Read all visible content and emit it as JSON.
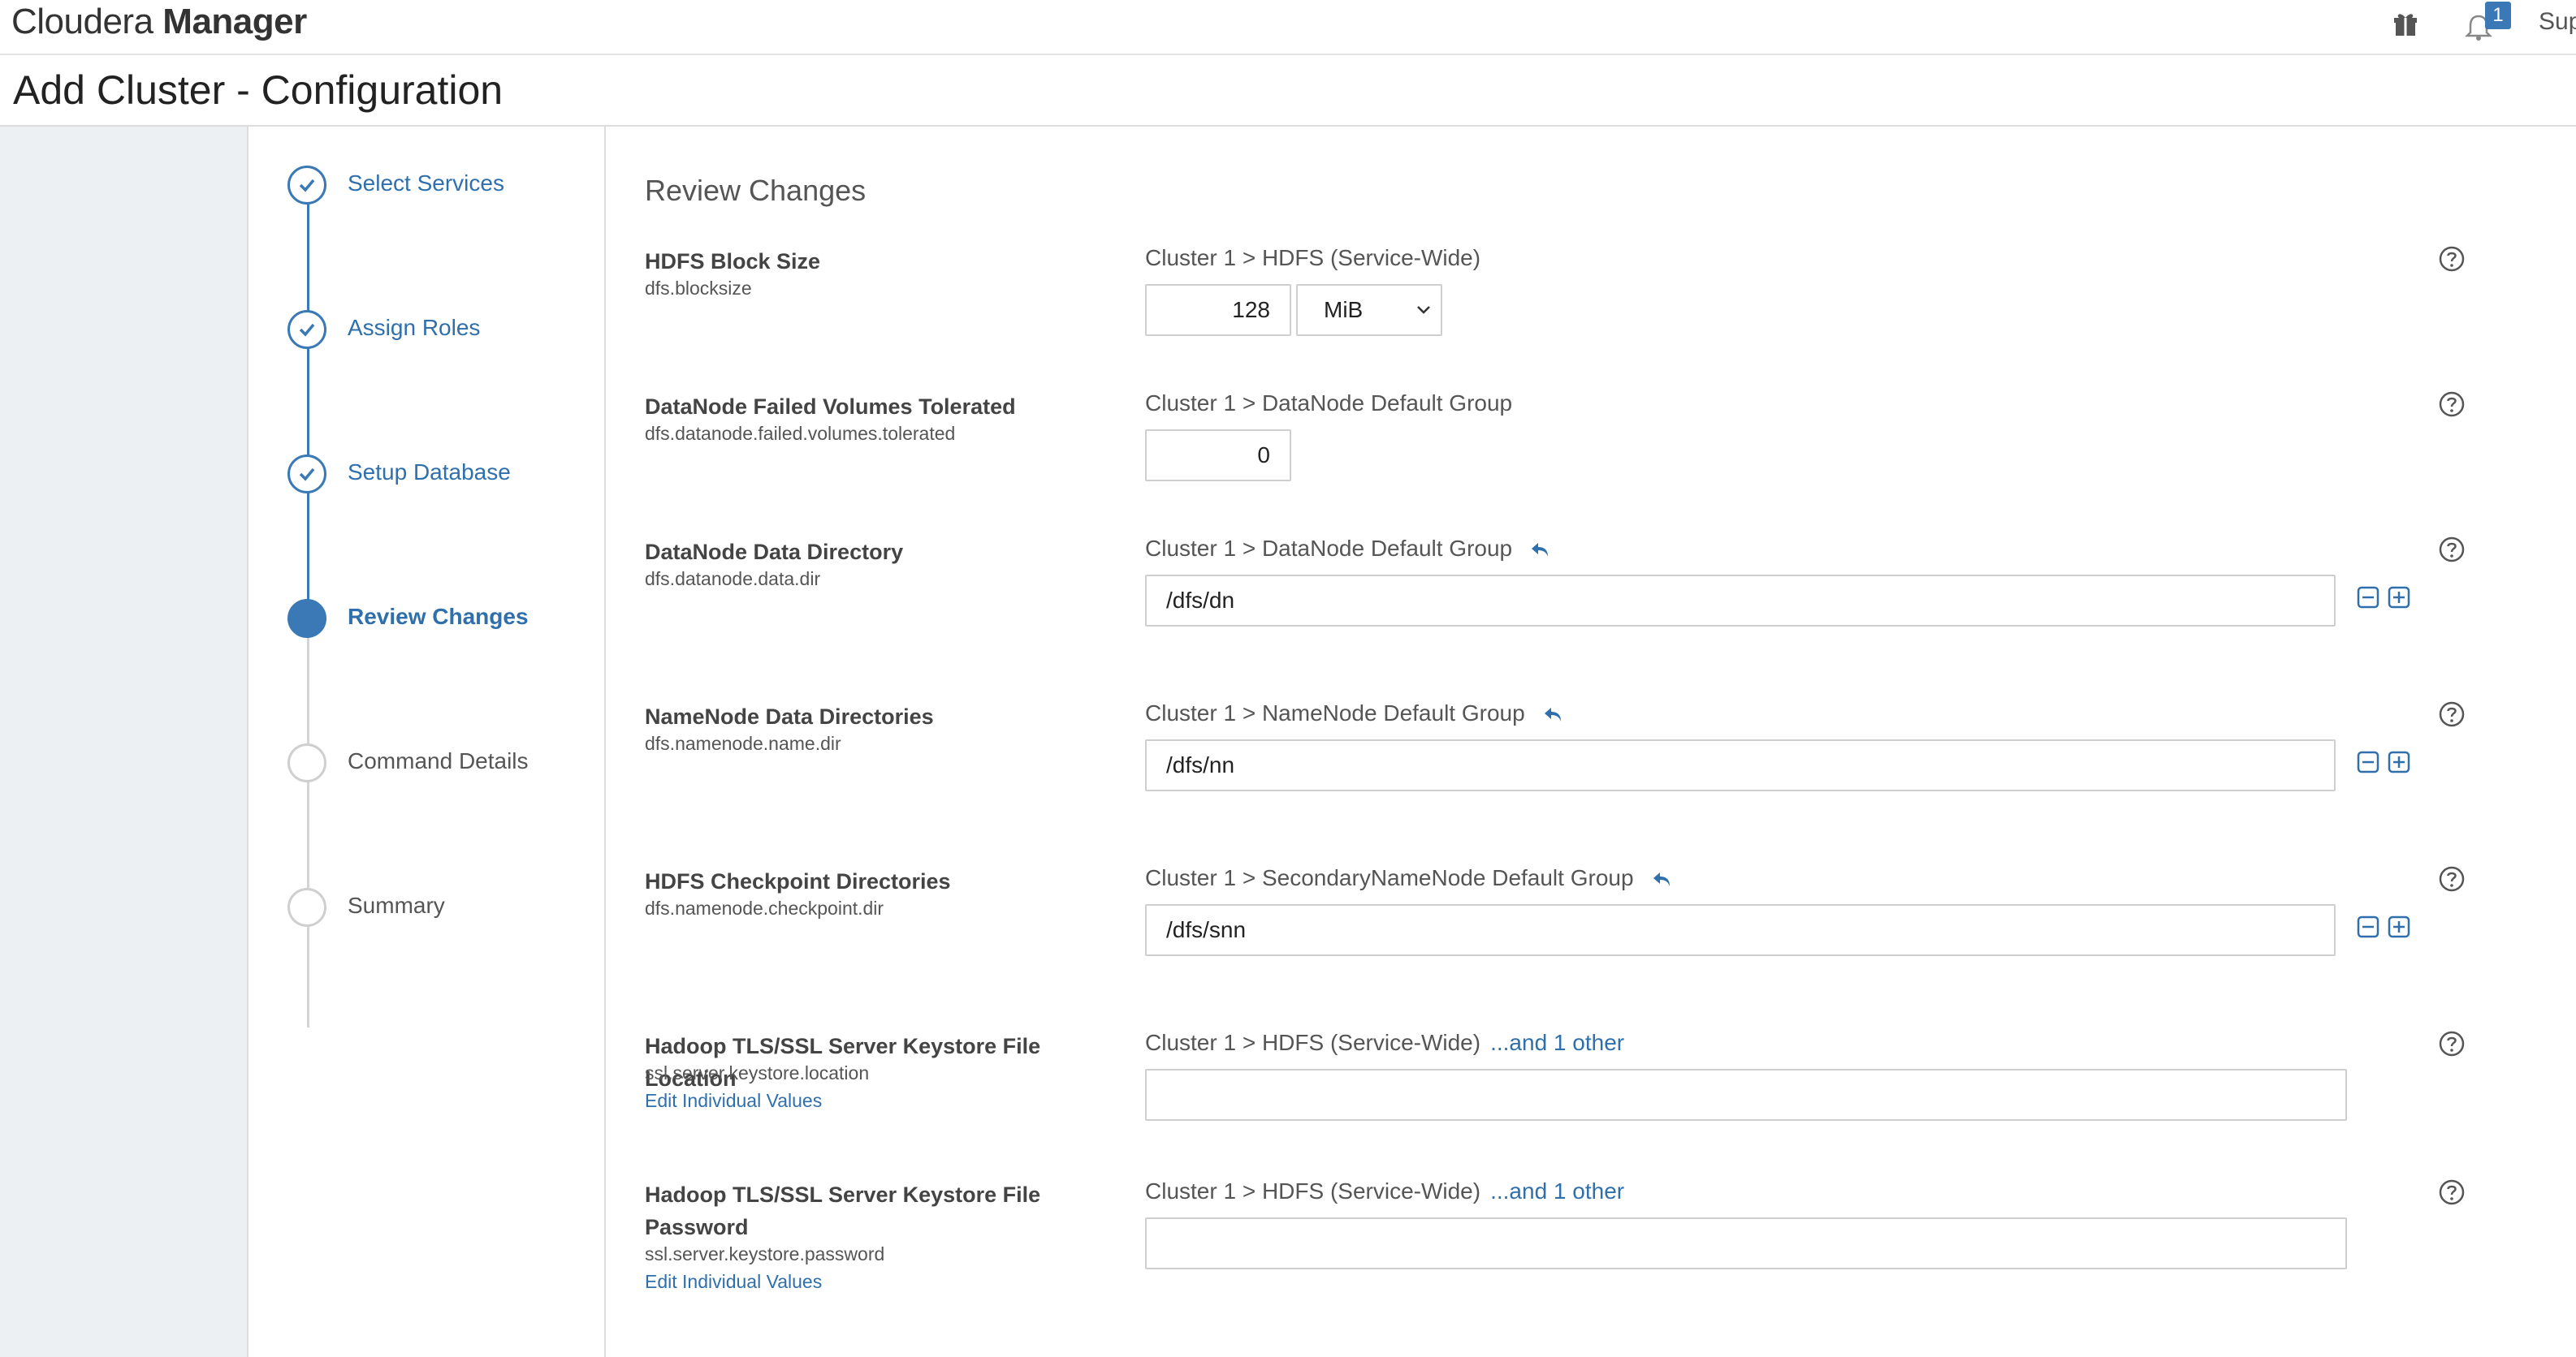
{
  "app": {
    "brand_light": "Cloudera",
    "brand_bold": "Manager",
    "notification_count": "1",
    "support_label": "Sup"
  },
  "page": {
    "title": "Add Cluster - Configuration"
  },
  "wizard": {
    "steps": [
      {
        "label": "Select Services",
        "state": "done"
      },
      {
        "label": "Assign Roles",
        "state": "done"
      },
      {
        "label": "Setup Database",
        "state": "done"
      },
      {
        "label": "Review Changes",
        "state": "current"
      },
      {
        "label": "Command Details",
        "state": "todo"
      },
      {
        "label": "Summary",
        "state": "todo"
      }
    ]
  },
  "main": {
    "section_title": "Review Changes",
    "params": [
      {
        "name": "HDFS Block Size",
        "key": "dfs.blocksize",
        "scope": "Cluster 1 > HDFS (Service-Wide)",
        "value": "128",
        "unit": "MiB"
      },
      {
        "name": "DataNode Failed Volumes Tolerated",
        "key": "dfs.datanode.failed.volumes.tolerated",
        "scope": "Cluster 1 > DataNode Default Group",
        "value": "0"
      },
      {
        "name": "DataNode Data Directory",
        "key": "dfs.datanode.data.dir",
        "scope": "Cluster 1 > DataNode Default Group",
        "value": "/dfs/dn"
      },
      {
        "name": "NameNode Data Directories",
        "key": "dfs.namenode.name.dir",
        "scope": "Cluster 1 > NameNode Default Group",
        "value": "/dfs/nn"
      },
      {
        "name": "HDFS Checkpoint Directories",
        "key": "dfs.namenode.checkpoint.dir",
        "scope": "Cluster 1 > SecondaryNameNode Default Group",
        "value": "/dfs/snn"
      },
      {
        "name": "Hadoop TLS/SSL Server Keystore File Location",
        "key": "ssl.server.keystore.location",
        "scope": "Cluster 1 > HDFS (Service-Wide)",
        "other_link": "...and 1 other",
        "edit_link": "Edit Individual Values",
        "value": ""
      },
      {
        "name": "Hadoop TLS/SSL Server Keystore File Password",
        "key": "ssl.server.keystore.password",
        "scope": "Cluster 1 > HDFS (Service-Wide)",
        "other_link": "...and 1 other",
        "edit_link": "Edit Individual Values",
        "value": ""
      }
    ]
  },
  "colors": {
    "accent": "#3a79b5",
    "link": "#2f6fac",
    "gutter": "#ecf0f3"
  }
}
